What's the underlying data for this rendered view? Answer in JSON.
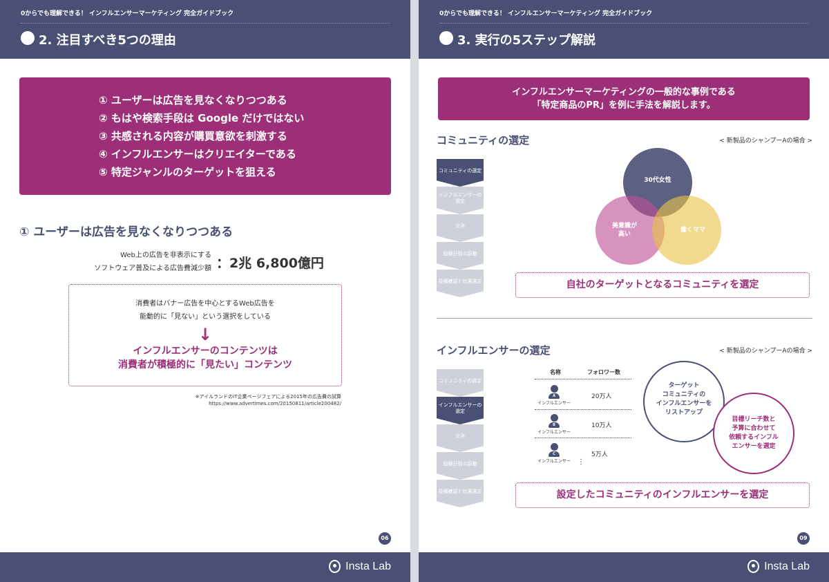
{
  "header_subtitle": "0からでも理解できる！ インフルエンサーマーケティング 完全ガイドブック",
  "brand": "Insta Lab",
  "colors": {
    "navy": "#4a5073",
    "magenta": "#9c2f78",
    "yellow": "#e8c449",
    "pink": "#be4f96"
  },
  "left": {
    "title": "2. 注目すべき5つの理由",
    "reasons": [
      "① ユーザーは広告を見なくなりつつある",
      "② もはや検索手段は Google だけではない",
      "③ 共感される内容が購買意欲を刺激する",
      "④ インフルエンサーはクリエイターである",
      "⑤ 特定ジャンルのターゲットを狙える"
    ],
    "section_title": "① ユーザーは広告を見なくなりつつある",
    "stat_label_1": "Web上の広告を非表示にする",
    "stat_label_2": "ソフトウェア普及による広告費減少額",
    "stat_value": "：2兆 6,800億円",
    "consumer_text_1": "消費者はバナー広告を中心とするWeb広告を",
    "consumer_text_2": "能動的に「見ない」という選択をしている",
    "arrow": "↓",
    "highlight_1": "インフルエンサーのコンテンツは",
    "highlight_2": "消費者が積極的に「見たい」コンテンツ",
    "note_1": "※アイルランドのIT企業ページフェアによる2015年の広告費の試算",
    "note_2": "https://www.advertimes.com/20150811/article200482/",
    "page_number": "06"
  },
  "right": {
    "title": "3. 実行の5ステップ解説",
    "case_1": "インフルエンサーマーケティングの一般的な事例である",
    "case_2": "「特定商品のPR」を例に手法を解説します。",
    "community_title": "コミュニティの選定",
    "case_note": "< 新製品のシャンプーAの場合 >",
    "steps": [
      "コミュニティの選定",
      "インフルエンサーの選定",
      "交渉",
      "投稿日程の調整",
      "投稿確認と効果測定"
    ],
    "venn": {
      "top": "30代女性",
      "left_1": "美意識が",
      "left_2": "高い",
      "right": "働くママ"
    },
    "community_banner": "自社のターゲットとなるコミュニティを選定",
    "influencer_title": "インフルエンサーの選定",
    "table_header_name": "名称",
    "table_header_followers": "フォロワー数",
    "influencers": [
      {
        "badge": "A",
        "label": "インフルエンサー",
        "followers": "20万人"
      },
      {
        "badge": "B",
        "label": "インフルエンサー",
        "followers": "10万人"
      },
      {
        "badge": "C",
        "label": "インフルエンサー",
        "followers": "5万人"
      }
    ],
    "more": "⋮",
    "circle_1": [
      "ターゲット",
      "コミュニティの",
      "インフルエンサーを",
      "リストアップ"
    ],
    "circle_2": [
      "目標リーチ数と",
      "予算に合わせて",
      "依頼するインフル",
      "エンサーを選定"
    ],
    "influencer_banner": "設定したコミュニティのインフルエンサーを選定",
    "page_number": "09"
  }
}
